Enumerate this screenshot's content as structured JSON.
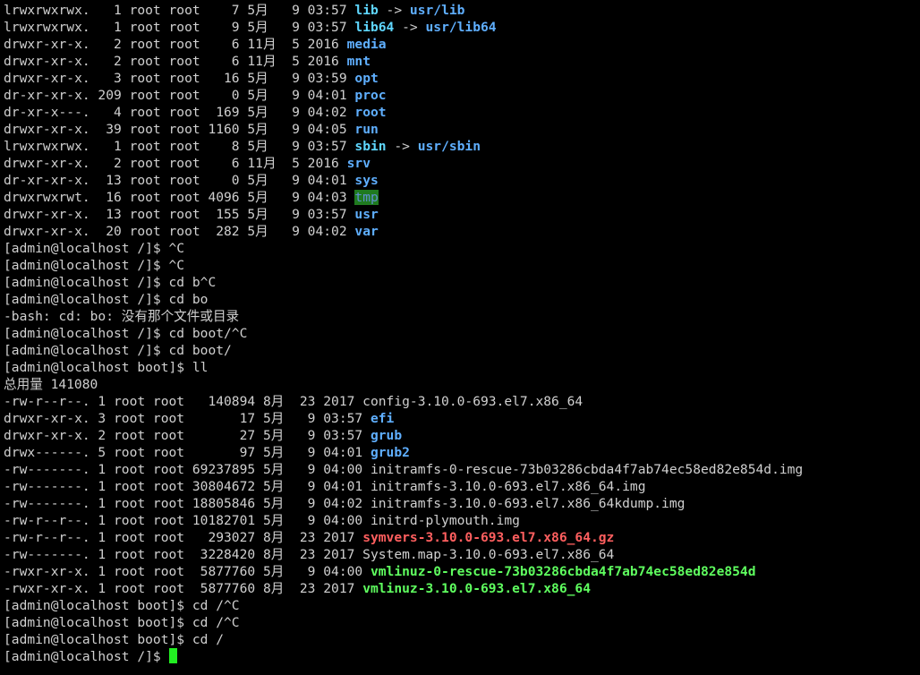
{
  "terminal": {
    "title": "",
    "cursor_color": "#22ee22",
    "lines": [
      [
        {
          "t": "lrwxrwxrwx.   1 root root    7 5月   9 03:57 "
        },
        {
          "t": "lib",
          "c": "link"
        },
        {
          "t": " -> "
        },
        {
          "t": "usr/lib",
          "c": "dir"
        }
      ],
      [
        {
          "t": "lrwxrwxrwx.   1 root root    9 5月   9 03:57 "
        },
        {
          "t": "lib64",
          "c": "link"
        },
        {
          "t": " -> "
        },
        {
          "t": "usr/lib64",
          "c": "dir"
        }
      ],
      [
        {
          "t": "drwxr-xr-x.   2 root root    6 11月  5 2016 "
        },
        {
          "t": "media",
          "c": "dir"
        }
      ],
      [
        {
          "t": "drwxr-xr-x.   2 root root    6 11月  5 2016 "
        },
        {
          "t": "mnt",
          "c": "dir"
        }
      ],
      [
        {
          "t": "drwxr-xr-x.   3 root root   16 5月   9 03:59 "
        },
        {
          "t": "opt",
          "c": "dir"
        }
      ],
      [
        {
          "t": "dr-xr-xr-x. 209 root root    0 5月   9 04:01 "
        },
        {
          "t": "proc",
          "c": "dir"
        }
      ],
      [
        {
          "t": "dr-xr-x---.   4 root root  169 5月   9 04:02 "
        },
        {
          "t": "root",
          "c": "dir"
        }
      ],
      [
        {
          "t": "drwxr-xr-x.  39 root root 1160 5月   9 04:05 "
        },
        {
          "t": "run",
          "c": "dir"
        }
      ],
      [
        {
          "t": "lrwxrwxrwx.   1 root root    8 5月   9 03:57 "
        },
        {
          "t": "sbin",
          "c": "link"
        },
        {
          "t": " -> "
        },
        {
          "t": "usr/sbin",
          "c": "dir"
        }
      ],
      [
        {
          "t": "drwxr-xr-x.   2 root root    6 11月  5 2016 "
        },
        {
          "t": "srv",
          "c": "dir"
        }
      ],
      [
        {
          "t": "dr-xr-xr-x.  13 root root    0 5月   9 04:01 "
        },
        {
          "t": "sys",
          "c": "dir"
        }
      ],
      [
        {
          "t": "drwxrwxrwt.  16 root root 4096 5月   9 04:03 "
        },
        {
          "t": "tmp",
          "c": "sticky"
        }
      ],
      [
        {
          "t": "drwxr-xr-x.  13 root root  155 5月   9 03:57 "
        },
        {
          "t": "usr",
          "c": "dir"
        }
      ],
      [
        {
          "t": "drwxr-xr-x.  20 root root  282 5月   9 04:02 "
        },
        {
          "t": "var",
          "c": "dir"
        }
      ],
      [
        {
          "t": "[admin@localhost /]$ ^C"
        }
      ],
      [
        {
          "t": "[admin@localhost /]$ ^C"
        }
      ],
      [
        {
          "t": "[admin@localhost /]$ cd b^C"
        }
      ],
      [
        {
          "t": "[admin@localhost /]$ cd bo"
        }
      ],
      [
        {
          "t": "-bash: cd: bo: 没有那个文件或目录"
        }
      ],
      [
        {
          "t": "[admin@localhost /]$ cd boot/^C"
        }
      ],
      [
        {
          "t": "[admin@localhost /]$ cd boot/"
        }
      ],
      [
        {
          "t": "[admin@localhost boot]$ ll"
        }
      ],
      [
        {
          "t": "总用量 141080"
        }
      ],
      [
        {
          "t": "-rw-r--r--. 1 root root   140894 8月  23 2017 config-3.10.0-693.el7.x86_64"
        }
      ],
      [
        {
          "t": "drwxr-xr-x. 3 root root       17 5月   9 03:57 "
        },
        {
          "t": "efi",
          "c": "dir"
        }
      ],
      [
        {
          "t": "drwxr-xr-x. 2 root root       27 5月   9 03:57 "
        },
        {
          "t": "grub",
          "c": "dir"
        }
      ],
      [
        {
          "t": "drwx------. 5 root root       97 5月   9 04:01 "
        },
        {
          "t": "grub2",
          "c": "dir"
        }
      ],
      [
        {
          "t": "-rw-------. 1 root root 69237895 5月   9 04:00 initramfs-0-rescue-73b03286cbda4f7ab74ec58ed82e854d.img"
        }
      ],
      [
        {
          "t": "-rw-------. 1 root root 30804672 5月   9 04:01 initramfs-3.10.0-693.el7.x86_64.img"
        }
      ],
      [
        {
          "t": "-rw-------. 1 root root 18805846 5月   9 04:02 initramfs-3.10.0-693.el7.x86_64kdump.img"
        }
      ],
      [
        {
          "t": "-rw-r--r--. 1 root root 10182701 5月   9 04:00 initrd-plymouth.img"
        }
      ],
      [
        {
          "t": "-rw-r--r--. 1 root root   293027 8月  23 2017 "
        },
        {
          "t": "symvers-3.10.0-693.el7.x86_64.gz",
          "c": "arch"
        }
      ],
      [
        {
          "t": "-rw-------. 1 root root  3228420 8月  23 2017 System.map-3.10.0-693.el7.x86_64"
        }
      ],
      [
        {
          "t": "-rwxr-xr-x. 1 root root  5877760 5月   9 04:00 "
        },
        {
          "t": "vmlinuz-0-rescue-73b03286cbda4f7ab74ec58ed82e854d",
          "c": "exec"
        }
      ],
      [
        {
          "t": "-rwxr-xr-x. 1 root root  5877760 8月  23 2017 "
        },
        {
          "t": "vmlinuz-3.10.0-693.el7.x86_64",
          "c": "exec"
        }
      ],
      [
        {
          "t": "[admin@localhost boot]$ cd /^C"
        }
      ],
      [
        {
          "t": "[admin@localhost boot]$ cd /^C"
        }
      ],
      [
        {
          "t": "[admin@localhost boot]$ cd /"
        }
      ],
      [
        {
          "t": "[admin@localhost /]$ "
        }
      ]
    ]
  }
}
